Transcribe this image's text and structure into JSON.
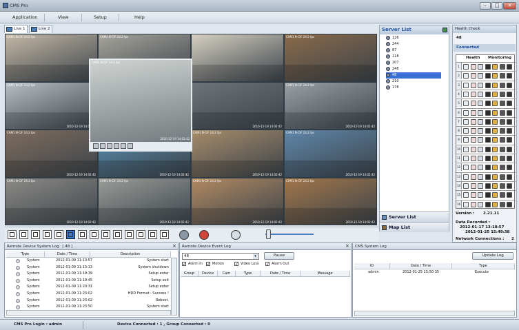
{
  "window": {
    "title": "CMS Pro",
    "controls": [
      "–",
      "□",
      "✕"
    ]
  },
  "menu": [
    "Application",
    "View",
    "Setup",
    "Help"
  ],
  "tabs": [
    "Live 1",
    "Live 2"
  ],
  "cameras": [
    {
      "label": "CAM1 N-CIF 24.2 fps",
      "ts": "",
      "color": "#c4b8a6"
    },
    {
      "label": "CAM1 N-CIF 24.2 fps",
      "ts": "",
      "color": "#a6a49c"
    },
    {
      "label": "",
      "ts": "",
      "color": "#d6d0c2"
    },
    {
      "label": "CAM1 N-CIF 24.2 fps",
      "ts": "",
      "color": "#8a6a4a"
    },
    {
      "label": "CAM1 N-CIF 24.2 fps",
      "ts": "2010-12-19 14:02:42",
      "color": "#b7bfc4"
    },
    {
      "label": "CAM1 N-CIF 24.2 fps",
      "ts": "2010-12-19 14:02:42",
      "color": "#c9cbc6"
    },
    {
      "label": "",
      "ts": "2010-12-19 14:02:42",
      "color": "#6e7478"
    },
    {
      "label": "CAM1 N-CIF 24.2 fps",
      "ts": "2010-12-19 14:02:42",
      "color": "#9aa0a4"
    },
    {
      "label": "CAM1 N-CIF 24.2 fps",
      "ts": "2010-12-19 14:02:42",
      "color": "#7e6c5e"
    },
    {
      "label": "",
      "ts": "2010-12-19 14:02:42",
      "color": "#5a8fb2"
    },
    {
      "label": "CAM1 N-CIF 24.2 fps",
      "ts": "2010-12-19 14:02:42",
      "color": "#a78c6a"
    },
    {
      "label": "CAM1 N-CIF 24.2 fps",
      "ts": "2010-12-19 14:02:42",
      "color": "#5f86a8"
    },
    {
      "label": "CAM1 N-CIF 24.2 fps",
      "ts": "2010-12-19 14:02:42",
      "color": "#8c8a86"
    },
    {
      "label": "CAM1 N-CIF 24.2 fps",
      "ts": "2010-12-19 14:02:42",
      "color": "#9a9c98"
    },
    {
      "label": "CAM1 N-CIF 24.2 fps",
      "ts": "2010-12-19 14:02:42",
      "color": "#b28a62"
    },
    {
      "label": "CAM1 N-CIF 24.2 fps",
      "ts": "2010-12-19 14:02:42",
      "color": "#a2764a"
    }
  ],
  "popup_camera": {
    "label": "CAM1 N-CIF 24.2 fps",
    "ts": "2010-12-19 14:02:42",
    "color": "#cfd4d2"
  },
  "server_list": {
    "title": "Server List",
    "items": [
      "126",
      "244",
      "87",
      "118",
      "207",
      "248",
      "48",
      "210",
      "178"
    ],
    "selected": "48",
    "sections": [
      "Server List",
      "Map List"
    ]
  },
  "health": {
    "title": "Health Check",
    "server_id": "48",
    "status": "Connected",
    "col_health": "Health",
    "col_monitoring": "Monitoring",
    "rows": [
      "1",
      "2",
      "3",
      "4",
      "5",
      "6",
      "7",
      "8",
      "9",
      "10",
      "11",
      "12",
      "13",
      "14",
      "15",
      "16"
    ],
    "version_label": "Version :",
    "version": "2.21.11",
    "data_recorded_label": "Data Recorded :",
    "data_recorded_start": "2012-01-17 13:18:57",
    "data_recorded_end": "2012-01-25 15:49:38",
    "network_label": "Network Connections :",
    "network_value": "2"
  },
  "system_log": {
    "title": "Remote Device System Log",
    "count": "[ 48 ]",
    "columns": [
      "Type",
      "Date / Time",
      "Description"
    ],
    "rows": [
      [
        "System",
        "2012-01-09 11:13:57",
        "System start"
      ],
      [
        "System",
        "2012-01-09 11:13:13",
        "System shutdown"
      ],
      [
        "System",
        "2012-01-09 11:19:39",
        "Setup enter"
      ],
      [
        "System",
        "2012-01-09 11:19:45",
        "Setup exit"
      ],
      [
        "System",
        "2012-01-09 11:20:31",
        "Setup enter"
      ],
      [
        "System",
        "2012-01-09 11:23:02",
        "HDD Format : Success !"
      ],
      [
        "System",
        "2012-01-09 11:23:02",
        "Reboot."
      ],
      [
        "System",
        "2012-01-09 11:23:50",
        "System start"
      ],
      [
        "System",
        "2012-01-09 11:24:05",
        "Setup enter"
      ]
    ]
  },
  "event_log": {
    "title": "Remote Device Event Log",
    "select_value": "48",
    "pause_label": "Pause",
    "filters": [
      "Alarm In",
      "Motion",
      "Video Loss",
      "Alarm Out"
    ],
    "columns": [
      "Group",
      "Device",
      "Cam",
      "Type",
      "Date / Time",
      "Message"
    ]
  },
  "cms_log": {
    "title": "CMS System Log",
    "update_label": "Update Log",
    "columns": [
      "ID",
      "Date / Time",
      "Type"
    ],
    "rows": [
      [
        "admin",
        "2012-01-25 15:50:35",
        "Execute"
      ]
    ]
  },
  "status_bar": {
    "login": "CMS Pro Login : admin",
    "connected": "Device Connected : 1 , Group Connected : 0"
  },
  "colors": {
    "accent": "#3a6fd3",
    "connected": "#1a4aa0"
  }
}
